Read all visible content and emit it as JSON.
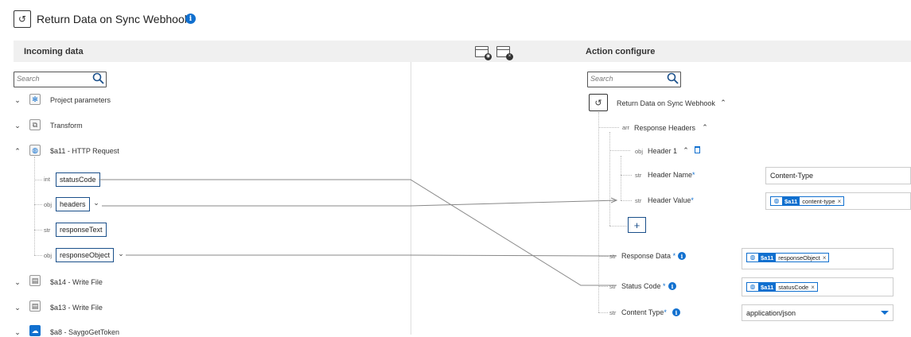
{
  "title": {
    "text": "Return Data on Sync Webhook",
    "info": "i"
  },
  "left": {
    "heading": "Incoming data",
    "search_placeholder": "Search",
    "nodes": [
      {
        "label": "Project parameters",
        "icon": "settings-icon",
        "expand": "⌄"
      },
      {
        "label": "Transform",
        "icon": "transform-icon",
        "expand": "⌄"
      },
      {
        "label": "$a11 - HTTP Request",
        "icon": "globe-icon",
        "expand": "⌃"
      },
      {
        "label": "$a14 - Write File",
        "icon": "file-icon",
        "expand": "⌄"
      },
      {
        "label": "$a13 - Write File",
        "icon": "file-icon",
        "expand": "⌄"
      },
      {
        "label": "$a8 - SaygoGetToken",
        "icon": "cloud-icon",
        "expand": "⌄"
      }
    ],
    "fields": [
      {
        "type": "int",
        "name": "statusCode"
      },
      {
        "type": "obj",
        "name": "headers"
      },
      {
        "type": "str",
        "name": "responseText"
      },
      {
        "type": "obj",
        "name": "responseObject"
      }
    ]
  },
  "right": {
    "heading": "Action configure",
    "search_placeholder": "Search",
    "action_label": "Return Data on Sync Webhook",
    "response_headers": {
      "type": "arr",
      "label": "Response Headers"
    },
    "header1": {
      "type": "obj",
      "label": "Header 1"
    },
    "header_name": {
      "type": "str",
      "label": "Header Name",
      "required": "*",
      "value": "Content-Type"
    },
    "header_value": {
      "type": "str",
      "label": "Header Value",
      "required": "*",
      "chip_step": "$a11",
      "chip_value": "content-type"
    },
    "add_label": "+",
    "response_data": {
      "type": "str",
      "label": "Response Data",
      "required": "*",
      "chip_step": "$a11",
      "chip_value": "responseObject"
    },
    "status_code": {
      "type": "str",
      "label": "Status Code",
      "required": "*",
      "chip_step": "$a11",
      "chip_value": "statusCode"
    },
    "content_type": {
      "type": "str",
      "label": "Content Type",
      "required": "*",
      "value": "application/json"
    },
    "chip_close": "×"
  },
  "colors": {
    "accent": "#1170cf",
    "header_bg": "#f0f0f0",
    "border": "#1a4f8a"
  }
}
